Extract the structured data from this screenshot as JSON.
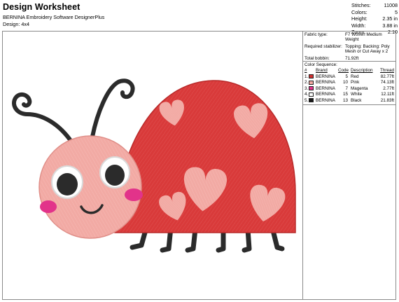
{
  "header": {
    "title": "Design Worksheet",
    "software": "BERNINA Embroidery Software DesignerPlus",
    "design": "Design:  4x4"
  },
  "stats": [
    {
      "label": "Stitches:",
      "value": "11008"
    },
    {
      "label": "Colors:",
      "value": "5"
    },
    {
      "label": "Height:",
      "value": "2.35 in"
    },
    {
      "label": "Width:",
      "value": "3.88 in"
    },
    {
      "label": "Zoom:",
      "value": "2.10"
    }
  ],
  "panel": {
    "fabric_label": "Fabric type:",
    "fabric_value": "F7 Woven Medium Weight",
    "stabilizer_label": "Required stabilizer:",
    "stabilizer_value": "Topping: Backing: Poly Mesh or Cut Away x 2",
    "bobbin_label": "Total bobbin:",
    "bobbin_value": "71.92ft",
    "sequence_title": "Color Sequence:",
    "columns": [
      "#",
      "Brand",
      "Code",
      "Description",
      "Thread"
    ],
    "colors": [
      {
        "index": "1.",
        "brand": "BERNINA",
        "code": "5",
        "description": "Red",
        "thread": "82.77ft",
        "hex": "#d32f2f"
      },
      {
        "index": "2.",
        "brand": "BERNINA",
        "code": "10",
        "description": "Pink",
        "thread": "74.13ft",
        "hex": "#f2a7a2"
      },
      {
        "index": "3.",
        "brand": "BERNINA",
        "code": "7",
        "description": "Magenta",
        "thread": "2.77ft",
        "hex": "#e2338a"
      },
      {
        "index": "4.",
        "brand": "BERNINA",
        "code": "15",
        "description": "White",
        "thread": "12.11ft",
        "hex": "#ffffff"
      },
      {
        "index": "5.",
        "brand": "BERNINA",
        "code": "13",
        "description": "Black",
        "thread": "21.83ft",
        "hex": "#1a1a1a"
      }
    ]
  },
  "palette": {
    "red": "#d93a3a",
    "red_dark": "#b82a2a",
    "pink": "#f2aaa4",
    "pink_dark": "#e08f89",
    "magenta": "#e2338a",
    "black": "#2b2b2b",
    "white": "#ffffff"
  }
}
